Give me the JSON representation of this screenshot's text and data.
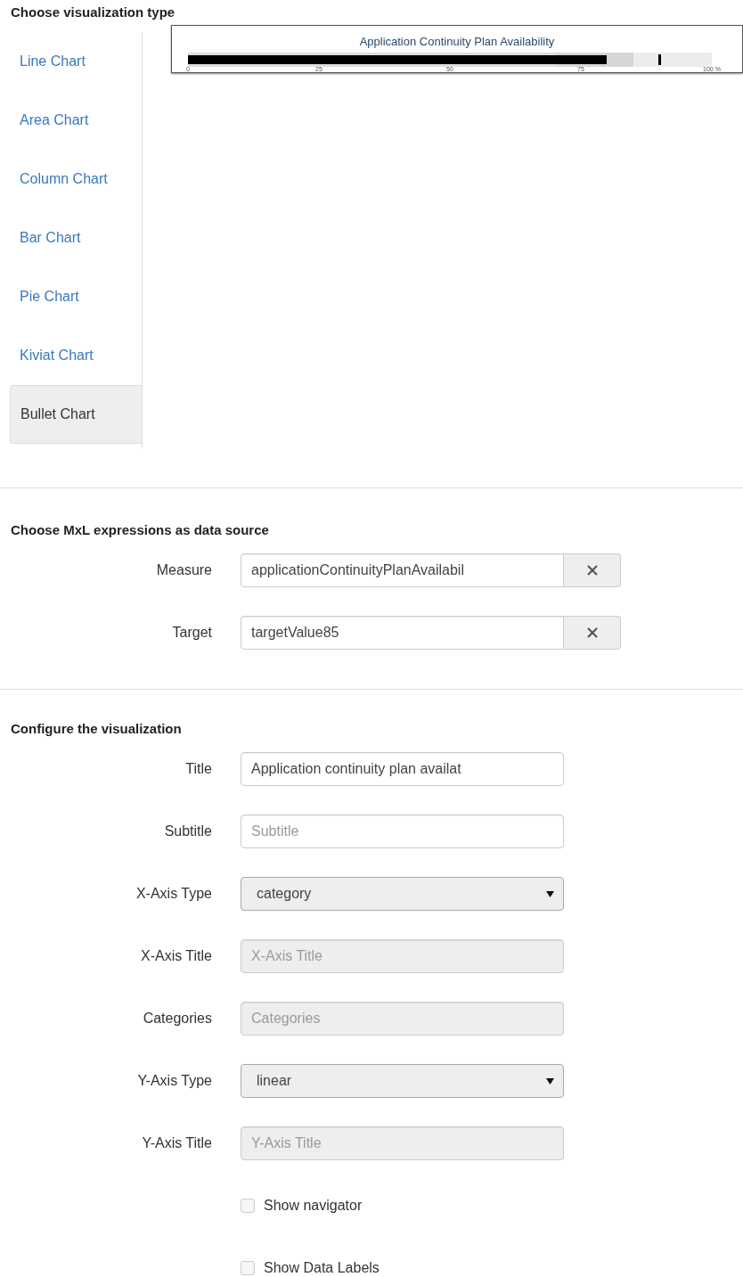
{
  "sections": [
    {
      "title": "Choose visualization type"
    },
    {
      "title": "Choose MxL expressions as data source"
    },
    {
      "title": "Configure the visualization"
    }
  ],
  "chart_types": [
    {
      "label": "Line Chart",
      "selected": false
    },
    {
      "label": "Area Chart",
      "selected": false
    },
    {
      "label": "Column Chart",
      "selected": false
    },
    {
      "label": "Bar Chart",
      "selected": false
    },
    {
      "label": "Pie Chart",
      "selected": false
    },
    {
      "label": "Kiviat Chart",
      "selected": false
    },
    {
      "label": "Bullet Chart",
      "selected": true
    }
  ],
  "preview": {
    "title": "Application Continuity Plan Availability",
    "bands": [
      {
        "level": 0.7
      },
      {
        "level": 0.85
      }
    ],
    "measure": {
      "level": 0.8
    },
    "target": {
      "level": 0.9
    },
    "axis_labels": [
      "0",
      "25",
      "50",
      "75",
      "100 %"
    ]
  },
  "data_source": [
    {
      "label": "Measure",
      "value": "applicationContinuityPlanAvailabil"
    },
    {
      "label": "Target",
      "value": "targetValue85"
    }
  ],
  "config": [
    {
      "kind": "text",
      "label": "Title",
      "value": "Application continuity plan availat",
      "disabled": false
    },
    {
      "kind": "text",
      "label": "Subtitle",
      "placeholder": "Subtitle",
      "disabled": false
    },
    {
      "kind": "select",
      "label": "X-Axis Type",
      "value": "category",
      "disabled": false
    },
    {
      "kind": "text",
      "label": "X-Axis Title",
      "placeholder": "X-Axis Title",
      "disabled": true
    },
    {
      "kind": "text",
      "label": "Categories",
      "placeholder": "Categories",
      "disabled": true
    },
    {
      "kind": "select",
      "label": "Y-Axis Type",
      "value": "linear",
      "disabled": false
    },
    {
      "kind": "text",
      "label": "Y-Axis Title",
      "placeholder": "Y-Axis Title",
      "disabled": true
    },
    {
      "kind": "checkbox",
      "label": "Show navigator",
      "checked": false
    },
    {
      "kind": "checkbox",
      "label": "Show Data Labels",
      "checked": false
    }
  ]
}
